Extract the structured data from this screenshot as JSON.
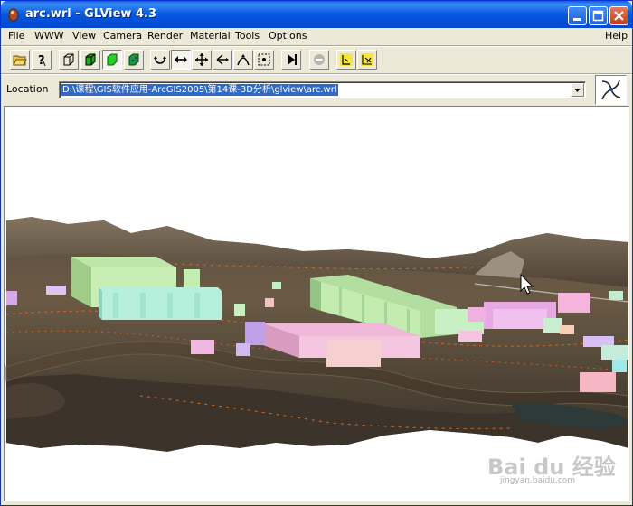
{
  "window": {
    "title": "arc.wrl - GLView 4.3",
    "accent": "#0458e0"
  },
  "caption_buttons": [
    "minimize-icon",
    "maximize-icon",
    "close-icon"
  ],
  "menu": {
    "items": [
      "File",
      "WWW",
      "View",
      "Camera",
      "Render",
      "Material",
      "Tools",
      "Options"
    ],
    "help": "Help"
  },
  "toolbar": {
    "icons": [
      "open-folder-icon",
      "help-pointer-icon",
      "wireframe-cube-icon",
      "flat-cube-icon",
      "smooth-cube-icon",
      "textured-cube-icon",
      "rotate-icon",
      "pan-icon",
      "move-icon",
      "fly-icon",
      "walk-icon",
      "seek-icon",
      "play-icon",
      "stop-icon",
      "viewpoint-icon",
      "viewpoint-cycle-icon"
    ]
  },
  "location": {
    "label": "Location",
    "value": "D:\\课程\\GIS软件应用-ArcGIS2005\\第14课-3D分析\\glview\\arc.wrl"
  },
  "scene": {
    "description_icon": "3d-terrain-scene",
    "sky_color": "#ffffff"
  },
  "watermark": {
    "main": "Bai du 经验",
    "sub": "jingyan.baidu.com"
  }
}
